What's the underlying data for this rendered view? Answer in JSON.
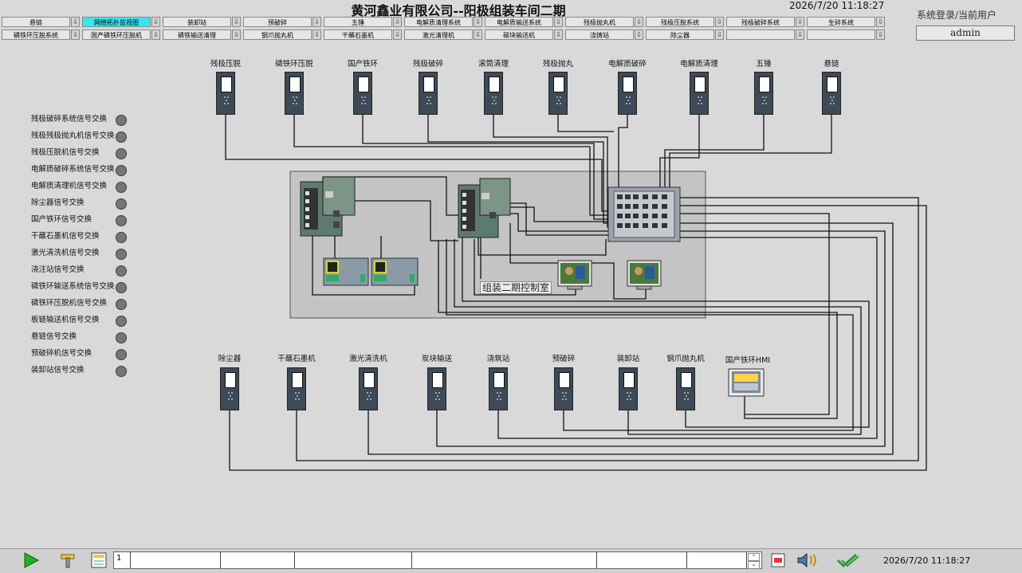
{
  "header": {
    "title": "黄河鑫业有限公司--阳极组装车间二期",
    "datetime": "2026/7/20 11:18:27",
    "login_label": "系统登录/当前用户",
    "current_user": "admin"
  },
  "nav": {
    "row1": [
      "悬链",
      "网络拓扑监视图",
      "装卸站",
      "预破碎",
      "五锤",
      "电解质清理系统",
      "电解质输送系统",
      "残极抛丸机",
      "残极压脱系统",
      "残极破碎系统",
      "生碎系统"
    ],
    "row2": [
      "磷铁环压脱系统",
      "国产磷铁环压脱机",
      "磷铁输送清理",
      "钢爪抛丸机",
      "干蘸石墨机",
      "激光清理机",
      "碳块输送机",
      "浇铸站",
      "除尘器",
      "",
      ""
    ],
    "active": "网络拓扑监视图",
    "arrow_glyph": "⇩"
  },
  "signals": [
    "残极破碎系统信号交换",
    "残极残极抛丸机信号交换",
    "残极压脱机信号交换",
    "电解质破碎系统信号交换",
    "电解质清理机信号交换",
    "除尘器信号交换",
    "国产铁环信号交换",
    "干蘸石墨机信号交换",
    "激光清洗机信号交换",
    "浇注站信号交换",
    "磷铁环输送系统信号交换",
    "磷铁环压脱机信号交换",
    "板链输送机信号交换",
    "悬链信号交换",
    "预破碎机信号交换",
    "装卸站信号交换"
  ],
  "top_devices": [
    "残极压脱",
    "磷铁环压脱",
    "国产铁环",
    "残极破碎",
    "滚筒清理",
    "残极抛丸",
    "电解质破碎",
    "电解质清理",
    "五锤",
    "悬链"
  ],
  "bottom_devices": [
    "除尘器",
    "干蘸石墨机",
    "激光清洗机",
    "炭块输送",
    "浇筑站",
    "预破碎",
    "装卸站",
    "钢爪抛丸机"
  ],
  "hmi_label": "国产铁环HMI",
  "control_room_label": "组装二期控制室",
  "taskbar": {
    "alarm_index": "1",
    "datetime": "2026/7/20 11:18:27"
  }
}
